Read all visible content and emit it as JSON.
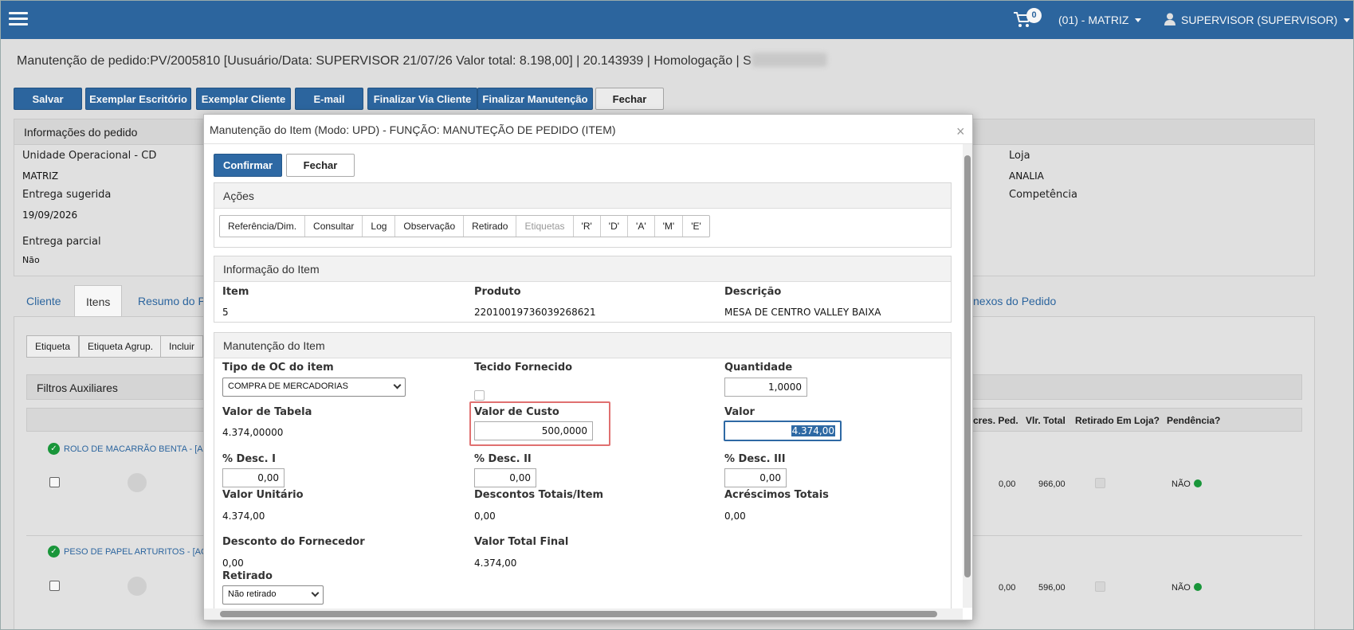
{
  "topbar": {
    "cart_count": "0",
    "unit_label": "(01) - MATRIZ",
    "user_label": "SUPERVISOR (SUPERVISOR)"
  },
  "page": {
    "title": "Manutenção de pedido:PV/2005810 [Uusuário/Data: SUPERVISOR 21/07/26 Valor total: 8.198,00] | 20.143939 | Homologação | S"
  },
  "toolbar": {
    "save": "Salvar",
    "office_copy": "Exemplar Escritório",
    "client_copy": "Exemplar Cliente",
    "email": "E-mail",
    "finish_client": "Finalizar Via Cliente",
    "finish_maintenance": "Finalizar Manutenção",
    "close": "Fechar"
  },
  "order_info": {
    "heading": "Informações do pedido",
    "unit_label": "Unidade Operacional - CD",
    "unit_value": "MATRIZ",
    "delivery_label": "Entrega sugerida",
    "delivery_value": "19/09/2026",
    "partial_label": "Entrega parcial",
    "partial_value": "Não",
    "store_label": "Loja",
    "store_value": "ANALIA",
    "competence_label": "Competência"
  },
  "tabs": {
    "client": "Cliente",
    "items": "Itens",
    "summary": "Resumo do Pe",
    "attachments": "nexos do Pedido"
  },
  "items_toolbar": {
    "label": "Etiqueta",
    "label_group": "Etiqueta Agrup.",
    "include": "Incluir"
  },
  "filters": {
    "heading": "Filtros Auxiliares"
  },
  "grid": {
    "headers": [
      "cres. Ped.",
      "Vlr. Total",
      "Retirado Em Loja?",
      "Pendência?"
    ],
    "rows": [
      {
        "name": "ROLO DE MACARRÃO BENTA - [AC",
        "acres": "0,00",
        "total": "966,00",
        "pendencia": "NÃO"
      },
      {
        "name": "PESO DE PAPEL ARTURITOS - [AC",
        "acres": "0,00",
        "total": "596,00",
        "pendencia": "NÃO"
      }
    ]
  },
  "modal": {
    "title": "Manutenção do Item (Modo: UPD) - FUNÇÃO: MANUTEÇÃO DE PEDIDO (ITEM)",
    "close_symbol": "×",
    "confirm": "Confirmar",
    "close": "Fechar",
    "actions": {
      "heading": "Ações",
      "buttons": [
        "Referência/Dim.",
        "Consultar",
        "Log",
        "Observação",
        "Retirado",
        "Etiquetas",
        "'R'",
        "'D'",
        "'A'",
        "'M'",
        "'E'"
      ]
    },
    "item_info": {
      "heading": "Informação do Item",
      "item_label": "Item",
      "item_value": "5",
      "product_label": "Produto",
      "product_value": "22010019736039268621",
      "description_label": "Descrição",
      "description_value": "MESA DE CENTRO VALLEY BAIXA"
    },
    "maintenance": {
      "heading": "Manutenção do Item",
      "oc_type_label": "Tipo de OC do item",
      "oc_type_value": "COMPRA DE MERCADORIAS",
      "fabric_label": "Tecido Fornecido",
      "quantity_label": "Quantidade",
      "quantity_value": "1,0000",
      "table_value_label": "Valor de Tabela",
      "table_value": "4.374,00000",
      "cost_label": "Valor de Custo",
      "cost_value": "500,0000",
      "value_label": "Valor",
      "value_value": "4.374,00",
      "disc1_label": "% Desc. I",
      "disc1_value": "0,00",
      "disc2_label": "% Desc. II",
      "disc2_value": "0,00",
      "disc3_label": "% Desc. III",
      "disc3_value": "0,00",
      "unit_value_label": "Valor Unitário",
      "unit_value": "4.374,00",
      "total_disc_label": "Descontos Totais/Item",
      "total_disc_value": "0,00",
      "total_add_label": "Acréscimos Totais",
      "total_add_value": "0,00",
      "supplier_disc_label": "Desconto do Fornecedor",
      "supplier_disc_value": "0,00",
      "final_total_label": "Valor Total Final",
      "final_total_value": "4.374,00",
      "withdrawn_label": "Retirado",
      "withdrawn_value": "Não retirado"
    }
  },
  "colors": {
    "primary": "#2e69a4",
    "highlight_border": "#e07070",
    "status_green": "#1a9b3c"
  }
}
